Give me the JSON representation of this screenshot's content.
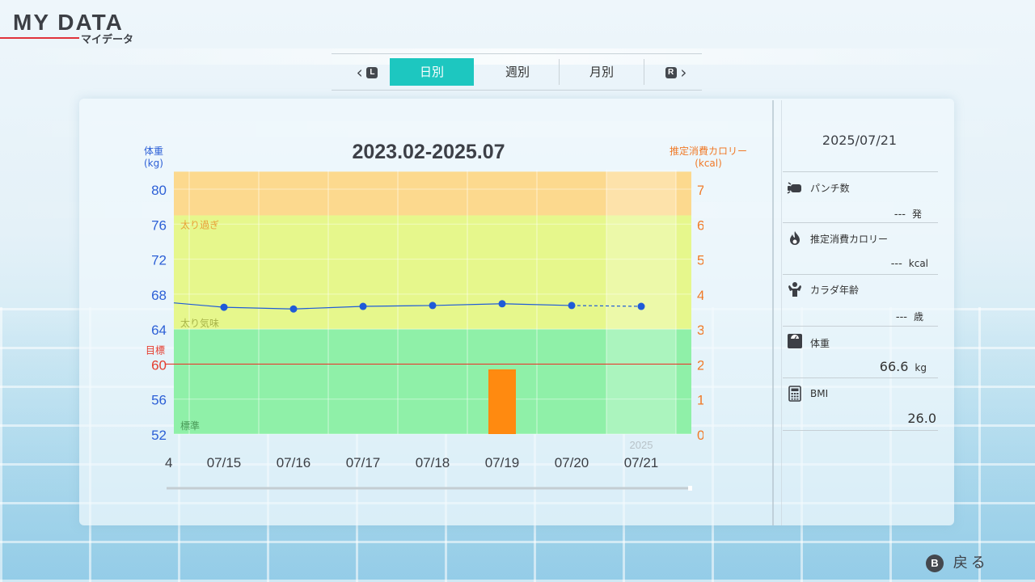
{
  "header": {
    "title": "MY DATA",
    "subtitle": "マイデータ"
  },
  "tabs": {
    "left_key": "L",
    "right_key": "R",
    "items": [
      {
        "label": "日別",
        "active": true
      },
      {
        "label": "週別",
        "active": false
      },
      {
        "label": "月別",
        "active": false
      }
    ]
  },
  "chart_data": {
    "type": "line",
    "title": "2023.02-2025.07",
    "ylabel_left": "体重\n(kg)",
    "ylabel_right": "推定消費カロリー\n(kcal)",
    "categories": [
      "07/15",
      "07/16",
      "07/17",
      "07/18",
      "07/19",
      "07/20",
      "07/21"
    ],
    "edge_label_left": "4",
    "year_marker": "2025",
    "y_left": {
      "min": 52,
      "max": 80,
      "ticks": [
        52,
        56,
        60,
        64,
        68,
        72,
        76,
        80
      ]
    },
    "y_right": {
      "min": 0,
      "max": 700,
      "ticks": [
        0,
        100,
        200,
        300,
        400,
        500,
        600,
        700
      ]
    },
    "series": [
      {
        "axis": "left",
        "kind": "line",
        "values": [
          66.5,
          66.3,
          66.6,
          66.7,
          66.9,
          66.7,
          66.6
        ],
        "color": "#1f5bd8"
      },
      {
        "axis": "right",
        "kind": "bar",
        "values": [
          0,
          0,
          0,
          0,
          185,
          0,
          0
        ],
        "color": "#ff8a10"
      }
    ],
    "zones": [
      {
        "label": "標準",
        "from": 52,
        "to": 64,
        "color": "#8ff0a8"
      },
      {
        "label": "太り気味",
        "from": 64,
        "to": 77,
        "color": "#e6f78c"
      },
      {
        "label": "太り過ぎ",
        "from": 77,
        "to": 82,
        "color": "#fcd98e"
      }
    ],
    "target": {
      "label": "目標",
      "value": 60,
      "color": "#e53c2e"
    },
    "leading_value": 67.0
  },
  "side": {
    "date": "2025/07/21",
    "rows": [
      {
        "icon": "punch-icon",
        "label": "パンチ数",
        "value": "---",
        "unit": "発"
      },
      {
        "icon": "flame-icon",
        "label": "推定消費カロリー",
        "value": "---",
        "unit": "kcal"
      },
      {
        "icon": "muscle-icon",
        "label": "カラダ年齢",
        "value": "---",
        "unit": "歳"
      },
      {
        "icon": "scale-icon",
        "label": "体重",
        "value": "66.6",
        "unit": "kg"
      },
      {
        "icon": "calculator-icon",
        "label": "BMI",
        "value": "26.0",
        "unit": ""
      }
    ]
  },
  "footer": {
    "back_key": "B",
    "back_label": "戻る"
  },
  "colors": {
    "accent": "#1dc7c0",
    "weight": "#1f5bd8",
    "calorie": "#f07a28",
    "target": "#e53c2e"
  }
}
